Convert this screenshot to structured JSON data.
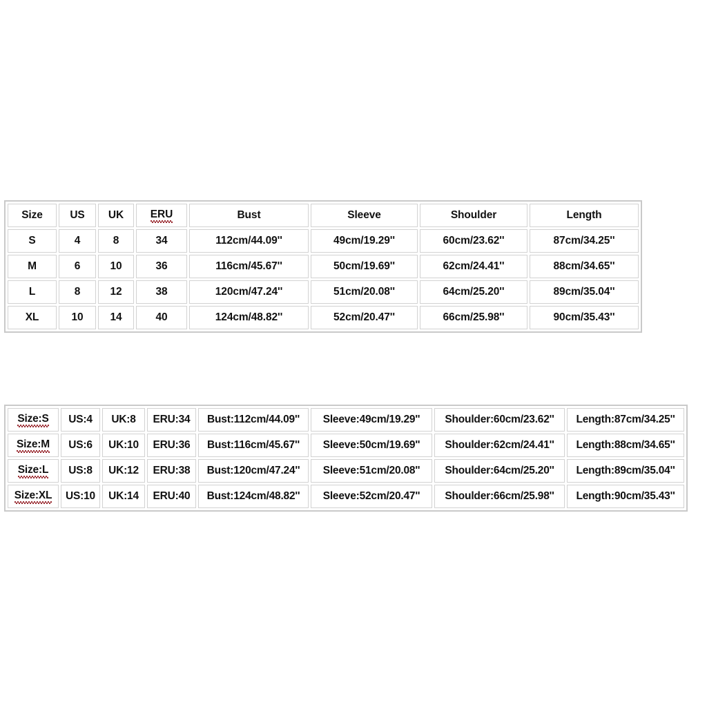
{
  "page": {
    "background_color": "#ffffff",
    "text_color": "#111111",
    "cell_border_color": "#d2d2d2",
    "table_border_color": "#c9c9c9",
    "spellcheck_underline_color": "#9c2f35"
  },
  "detailed_table": {
    "headers": [
      "Size",
      "US",
      "UK",
      "ERU",
      "Bust",
      "Sleeve",
      "Shoulder",
      "Length"
    ],
    "header_spellcheck_flags": [
      false,
      false,
      false,
      true,
      false,
      false,
      false,
      false
    ],
    "rows": [
      {
        "size": "S",
        "us": "4",
        "uk": "8",
        "eru": "34",
        "bust": "112cm/44.09''",
        "sleeve": "49cm/19.29''",
        "shoulder": "60cm/23.62''",
        "length": "87cm/34.25''"
      },
      {
        "size": "M",
        "us": "6",
        "uk": "10",
        "eru": "36",
        "bust": "116cm/45.67''",
        "sleeve": "50cm/19.69''",
        "shoulder": "62cm/24.41''",
        "length": "88cm/34.65''"
      },
      {
        "size": "L",
        "us": "8",
        "uk": "12",
        "eru": "38",
        "bust": "120cm/47.24''",
        "sleeve": "51cm/20.08''",
        "shoulder": "64cm/25.20''",
        "length": "89cm/35.04''"
      },
      {
        "size": "XL",
        "us": "10",
        "uk": "14",
        "eru": "40",
        "bust": "124cm/48.82''",
        "sleeve": "52cm/20.47''",
        "shoulder": "66cm/25.98''",
        "length": "90cm/35.43''"
      }
    ]
  },
  "combined_table": {
    "rows": [
      {
        "size": "Size:S",
        "us": "US:4",
        "uk": "UK:8",
        "eru": "ERU:34",
        "bust": "Bust:112cm/44.09''",
        "sleeve": "Sleeve:49cm/19.29''",
        "shoulder": "Shoulder:60cm/23.62''",
        "length": "Length:87cm/34.25''"
      },
      {
        "size": "Size:M",
        "us": "US:6",
        "uk": "UK:10",
        "eru": "ERU:36",
        "bust": "Bust:116cm/45.67''",
        "sleeve": "Sleeve:50cm/19.69''",
        "shoulder": "Shoulder:62cm/24.41''",
        "length": "Length:88cm/34.65''"
      },
      {
        "size": "Size:L",
        "us": "US:8",
        "uk": "UK:12",
        "eru": "ERU:38",
        "bust": "Bust:120cm/47.24''",
        "sleeve": "Sleeve:51cm/20.08''",
        "shoulder": "Shoulder:64cm/25.20''",
        "length": "Length:89cm/35.04''"
      },
      {
        "size": "Size:XL",
        "us": "US:10",
        "uk": "UK:14",
        "eru": "ERU:40",
        "bust": "Bust:124cm/48.82''",
        "sleeve": "Sleeve:52cm/20.47''",
        "shoulder": "Shoulder:66cm/25.98''",
        "length": "Length:90cm/35.43''"
      }
    ]
  }
}
